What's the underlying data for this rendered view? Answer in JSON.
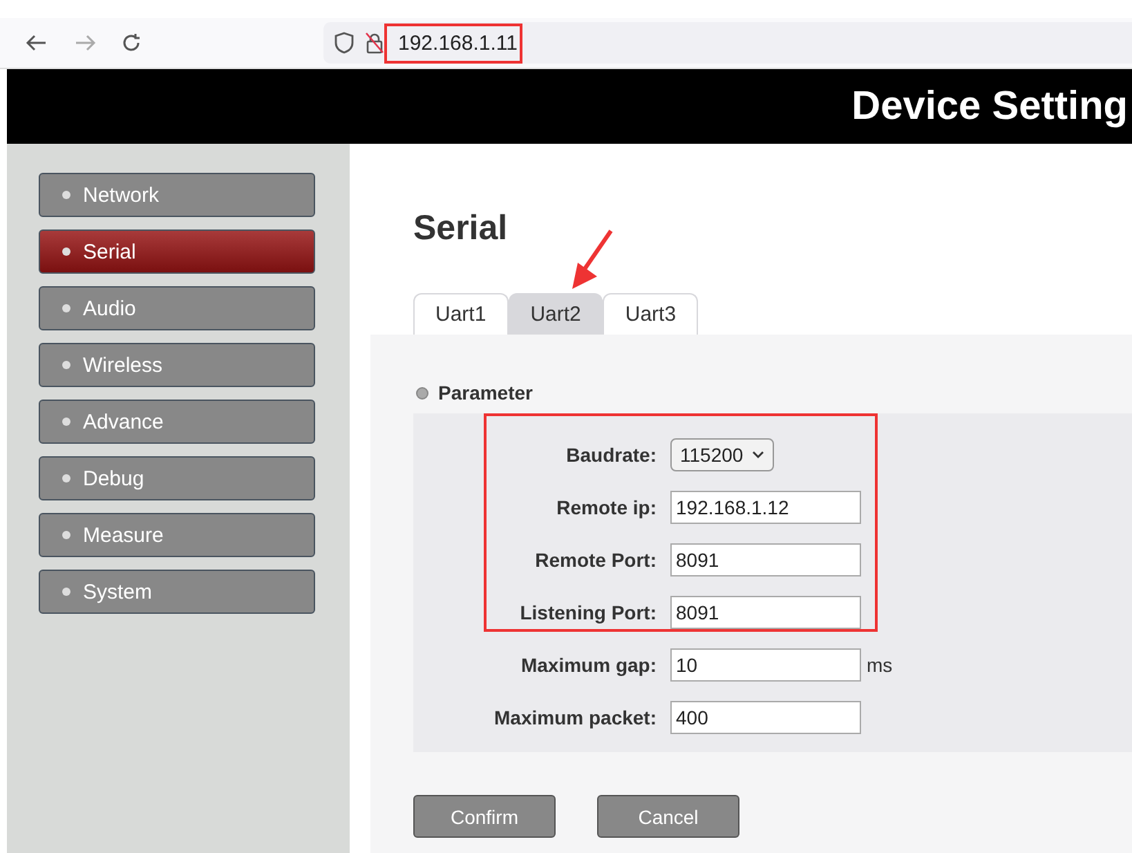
{
  "browser": {
    "address": "192.168.1.11"
  },
  "header": {
    "title": "Device Setting"
  },
  "sidebar": {
    "items": [
      {
        "label": "Network",
        "selected": false
      },
      {
        "label": "Serial",
        "selected": true
      },
      {
        "label": "Audio",
        "selected": false
      },
      {
        "label": "Wireless",
        "selected": false
      },
      {
        "label": "Advance",
        "selected": false
      },
      {
        "label": "Debug",
        "selected": false
      },
      {
        "label": "Measure",
        "selected": false
      },
      {
        "label": "System",
        "selected": false
      }
    ]
  },
  "page": {
    "title": "Serial",
    "tabs": [
      {
        "label": "Uart1",
        "selected": false
      },
      {
        "label": "Uart2",
        "selected": true
      },
      {
        "label": "Uart3",
        "selected": false
      }
    ],
    "section": "Parameter",
    "fields": [
      {
        "kind": "select",
        "label": "Baudrate:",
        "value": "115200"
      },
      {
        "kind": "text",
        "label": "Remote ip:",
        "value": "192.168.1.12"
      },
      {
        "kind": "text",
        "label": "Remote Port:",
        "value": "8091"
      },
      {
        "kind": "text",
        "label": "Listening Port:",
        "value": "8091"
      },
      {
        "kind": "text",
        "label": "Maximum gap:",
        "value": "10",
        "unit": "ms"
      },
      {
        "kind": "text",
        "label": "Maximum packet:",
        "value": "400"
      }
    ],
    "buttons": [
      "Confirm",
      "Cancel"
    ]
  }
}
